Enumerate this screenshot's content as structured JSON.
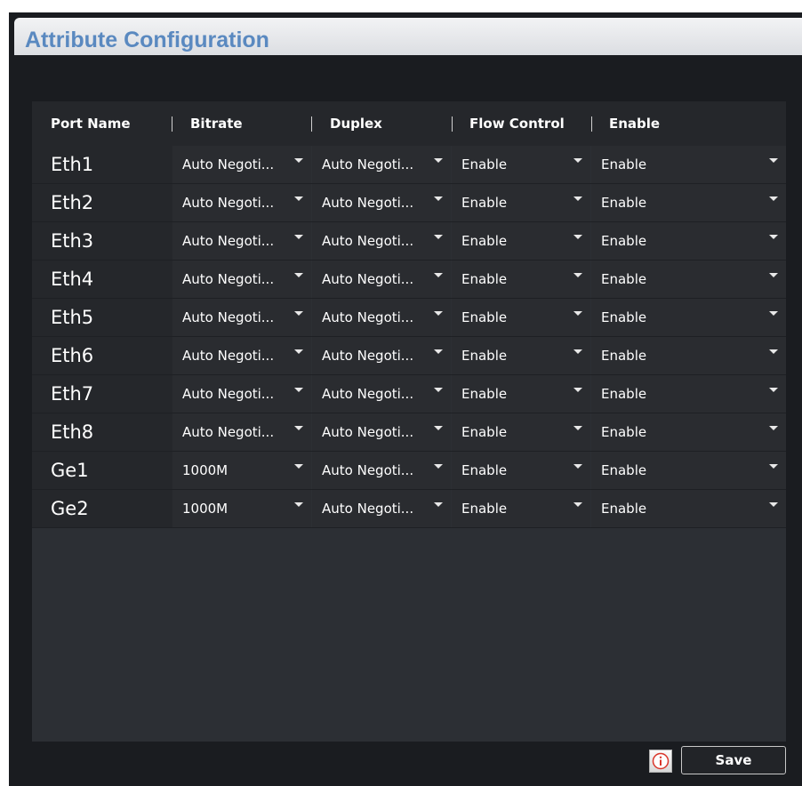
{
  "page": {
    "title": "Attribute Configuration"
  },
  "table": {
    "columns": [
      "Port Name",
      "Bitrate",
      "Duplex",
      "Flow Control",
      "Enable"
    ],
    "rows": [
      {
        "port": "Eth1",
        "bitrate": "Auto Negoti...",
        "duplex": "Auto Negoti...",
        "flow_control": "Enable",
        "enable": "Enable"
      },
      {
        "port": "Eth2",
        "bitrate": "Auto Negoti...",
        "duplex": "Auto Negoti...",
        "flow_control": "Enable",
        "enable": "Enable"
      },
      {
        "port": "Eth3",
        "bitrate": "Auto Negoti...",
        "duplex": "Auto Negoti...",
        "flow_control": "Enable",
        "enable": "Enable"
      },
      {
        "port": "Eth4",
        "bitrate": "Auto Negoti...",
        "duplex": "Auto Negoti...",
        "flow_control": "Enable",
        "enable": "Enable"
      },
      {
        "port": "Eth5",
        "bitrate": "Auto Negoti...",
        "duplex": "Auto Negoti...",
        "flow_control": "Enable",
        "enable": "Enable"
      },
      {
        "port": "Eth6",
        "bitrate": "Auto Negoti...",
        "duplex": "Auto Negoti...",
        "flow_control": "Enable",
        "enable": "Enable"
      },
      {
        "port": "Eth7",
        "bitrate": "Auto Negoti...",
        "duplex": "Auto Negoti...",
        "flow_control": "Enable",
        "enable": "Enable"
      },
      {
        "port": "Eth8",
        "bitrate": "Auto Negoti...",
        "duplex": "Auto Negoti...",
        "flow_control": "Enable",
        "enable": "Enable"
      },
      {
        "port": "Ge1",
        "bitrate": "1000M",
        "duplex": "Auto Negoti...",
        "flow_control": "Enable",
        "enable": "Enable"
      },
      {
        "port": "Ge2",
        "bitrate": "1000M",
        "duplex": "Auto Negoti...",
        "flow_control": "Enable",
        "enable": "Enable"
      }
    ]
  },
  "footer": {
    "info_icon": "info-icon",
    "save_label": "Save"
  },
  "colors": {
    "title_text": "#5a89c0",
    "background": "#1a1c20",
    "panel": "#2c2f34",
    "info_icon": "#d9362b"
  }
}
